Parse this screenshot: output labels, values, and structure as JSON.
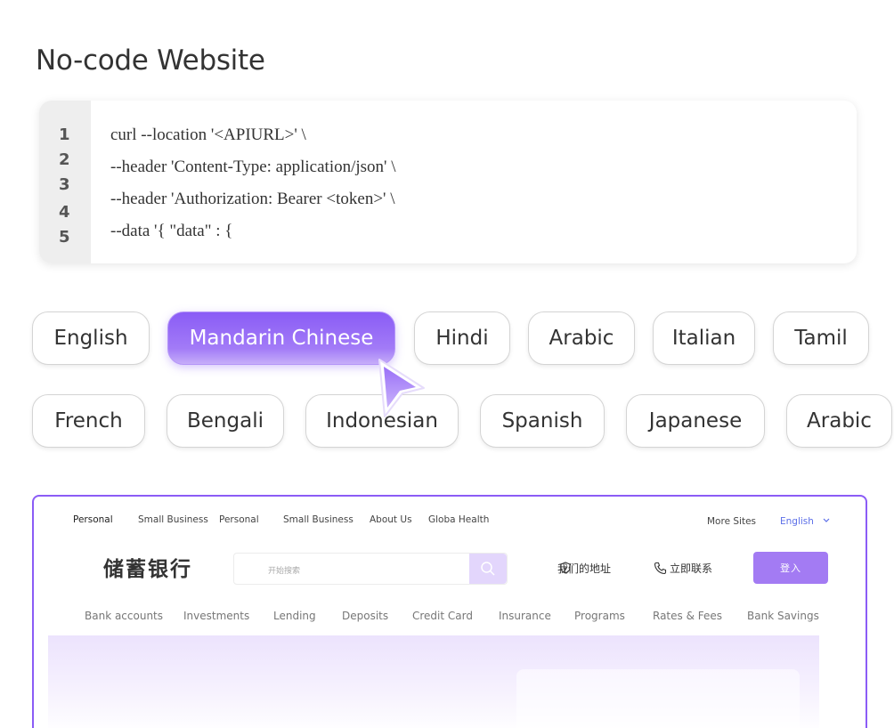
{
  "title": "No-code Website",
  "code": {
    "line_numbers": [
      "1",
      "2",
      "3",
      "4",
      "5"
    ],
    "lines": [
      "curl --location '<APIURL>' \\",
      "--header 'Content-Type: application/json' \\",
      "--header 'Authorization: Bearer <token>' \\",
      "--data '{ \"data\" : {"
    ]
  },
  "languages": {
    "row1": [
      "English",
      "Mandarin Chinese",
      "Hindi",
      "Arabic",
      "Italian",
      "Tamil"
    ],
    "row2": [
      "French",
      "Bengali",
      "Indonesian",
      "Spanish",
      "Japanese",
      "Arabic"
    ],
    "selected": "Mandarin Chinese"
  },
  "site": {
    "top_nav": [
      "Personal",
      "Small Business",
      "Personal",
      "Small Business",
      "About Us",
      "Globa Health"
    ],
    "more_sites": "More Sites",
    "language": "English",
    "brand": "储蓄银行",
    "search_placeholder": "开始搜索",
    "address_label": "我们的地址",
    "contact_label": "立即联系",
    "login_label": "登入",
    "main_nav": [
      "Bank accounts",
      "Investments",
      "Lending",
      "Deposits",
      "Credit Card",
      "Insurance",
      "Programs",
      "Rates & Fees",
      "Bank Savings"
    ],
    "accent_color": "#8b5cf6"
  }
}
